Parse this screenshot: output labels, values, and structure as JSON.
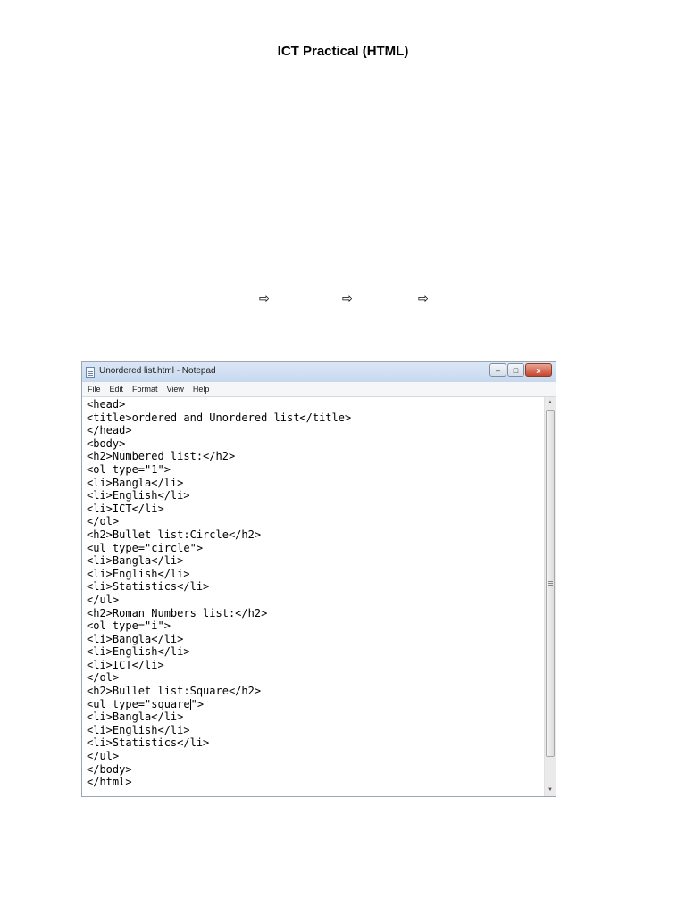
{
  "page": {
    "title": "ICT Practical (HTML)",
    "arrows": [
      "⇨",
      "⇨",
      "⇨"
    ]
  },
  "notepad": {
    "window_title": "Unordered list.html - Notepad",
    "icon": "notepad-icon",
    "controls": {
      "minimize": "–",
      "maximize": "□",
      "close": "x"
    },
    "menu": [
      "File",
      "Edit",
      "Format",
      "View",
      "Help"
    ],
    "code_lines": [
      "<head>",
      "<title>ordered and Unordered list</title>",
      "</head>",
      "<body>",
      "<h2>Numbered list:</h2>",
      "<ol type=\"1\">",
      "<li>Bangla</li>",
      "<li>English</li>",
      "<li>ICT</li>",
      "</ol>",
      "<h2>Bullet list:Circle</h2>",
      "<ul type=\"circle\">",
      "<li>Bangla</li>",
      "<li>English</li>",
      "<li>Statistics</li>",
      "</ul>",
      "<h2>Roman Numbers list:</h2>",
      "<ol type=\"i\">",
      "<li>Bangla</li>",
      "<li>English</li>",
      "<li>ICT</li>",
      "</ol>",
      "<h2>Bullet list:Square</h2>",
      "<ul type=\"square\">",
      "<li>Bangla</li>",
      "<li>English</li>",
      "<li>Statistics</li>",
      "</ul>",
      "</body>",
      "</html>"
    ],
    "scroll_up": "▲",
    "scroll_down": "▼"
  }
}
